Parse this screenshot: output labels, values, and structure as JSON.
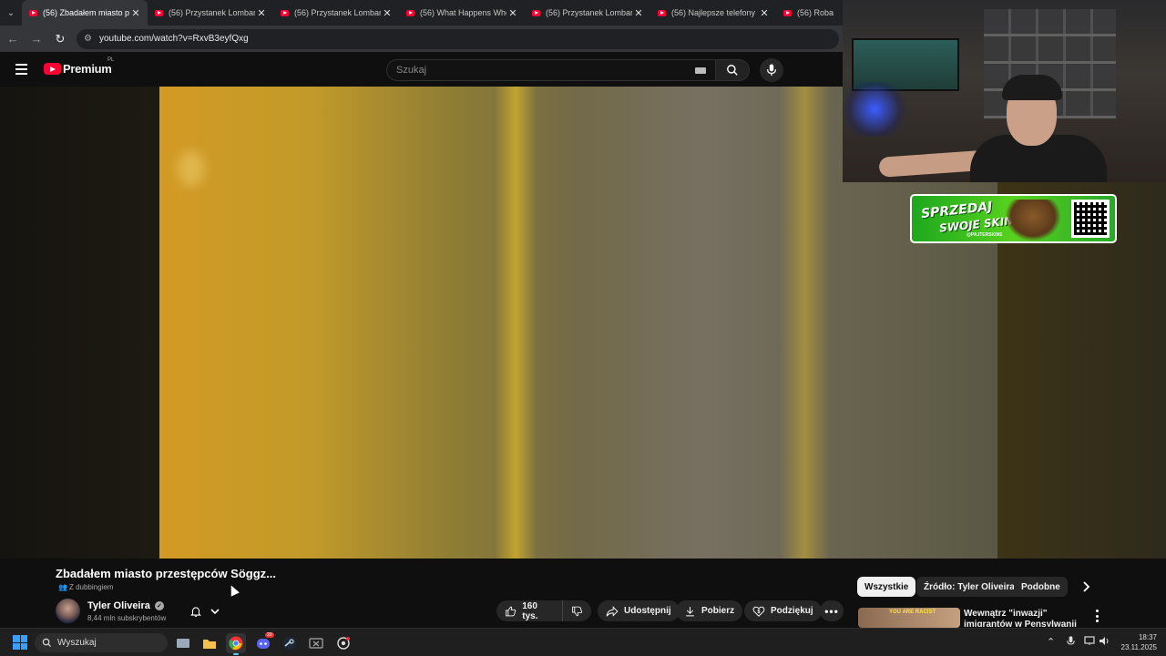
{
  "browser": {
    "tabs": [
      {
        "label": "(56) Zbadałem miasto prze",
        "active": true
      },
      {
        "label": "(56) Przystanek Lombard",
        "active": false
      },
      {
        "label": "(56) Przystanek Lombard",
        "active": false
      },
      {
        "label": "(56) What Happens When",
        "active": false
      },
      {
        "label": "(56) Przystanek Lombard",
        "active": false
      },
      {
        "label": "(56) Najlepsze telefony ro",
        "active": false
      },
      {
        "label": "(56) Robalini",
        "active": false
      }
    ],
    "url": "youtube.com/watch?v=RxvB3eyfQxg"
  },
  "youtube": {
    "logo_text": "Premium",
    "region": "PL",
    "search_placeholder": "Szukaj"
  },
  "stream_overlay": {
    "promo_line1": "SPRZEDAJ",
    "promo_line2": "SWOJE SKINY",
    "promo_handle": "@PAJTERSKINS"
  },
  "video": {
    "title": "Zbadałem miasto przestępców Söggz...",
    "dub_label": "Z dubbingiem",
    "channel_name": "Tyler Oliveira",
    "subscribers": "8,44 mln subskrybentów",
    "likes": "160 tys.",
    "share_label": "Udostępnij",
    "download_label": "Pobierz",
    "thanks_label": "Podziękuj"
  },
  "sidebar": {
    "chips": [
      {
        "label": "Wszystkie",
        "selected": true
      },
      {
        "label": "Źródło: Tyler Oliveira",
        "selected": false
      },
      {
        "label": "Podobne",
        "selected": false
      }
    ],
    "recommendation": {
      "title": "Wewnątrz \"inwazji\" imigrantów w Pensylwanii",
      "thumb_text": "YOU ARE RACIST"
    }
  },
  "taskbar": {
    "search_label": "Wyszukaj",
    "time": "18:37",
    "date": "23.11.2025",
    "discord_badge": "20"
  }
}
